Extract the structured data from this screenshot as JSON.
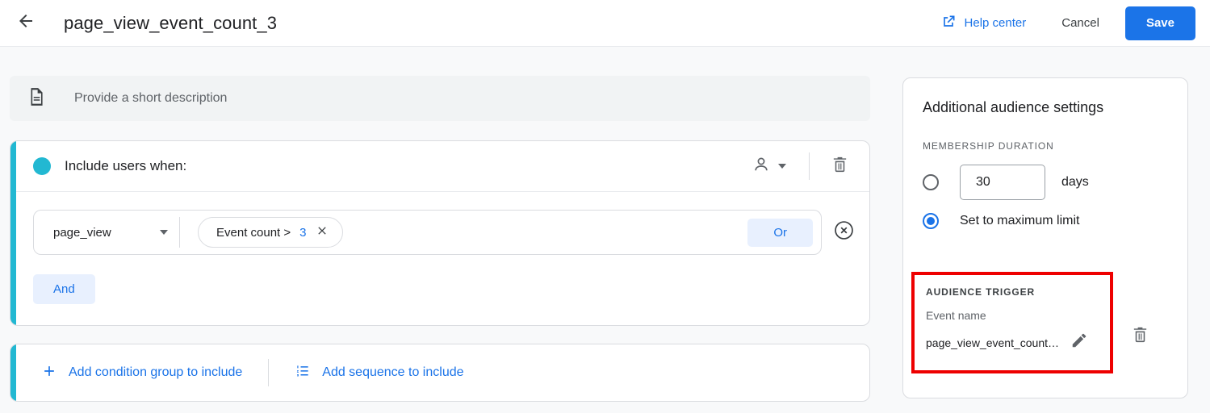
{
  "header": {
    "back_icon": "arrow-left-icon",
    "title": "page_view_event_count_3",
    "help_center_label": "Help center",
    "help_center_icon": "external-link-icon",
    "cancel_label": "Cancel",
    "save_label": "Save",
    "save_color": "#1b74e8",
    "help_link_color": "#1a73e8"
  },
  "description": {
    "icon": "document-icon",
    "placeholder": "Provide a short description"
  },
  "condition_card": {
    "accent_color": "#22b8d2",
    "header_label": "Include users when:",
    "scope_icon": "person-icon",
    "delete_icon": "trash-icon",
    "condition": {
      "dimension": "page_view",
      "chip_prefix": "Event count >",
      "chip_value": "3",
      "chip_close_icon": "close-icon",
      "or_label": "Or",
      "remove_icon": "circle-close-icon"
    },
    "and_label": "And"
  },
  "add_card": {
    "add_group_label": "Add condition group to include",
    "add_group_icon": "plus-icon",
    "add_sequence_label": "Add sequence to include",
    "add_sequence_icon": "numbered-list-icon"
  },
  "settings_panel": {
    "title": "Additional audience settings",
    "membership_duration_label": "MEMBERSHIP DURATION",
    "days_value": "30",
    "days_unit": "days",
    "max_limit_label": "Set to maximum limit",
    "selected_option": "max_limit",
    "accent_color": "#1a73e8",
    "audience_trigger": {
      "label": "AUDIENCE TRIGGER",
      "field_label": "Event name",
      "value": "page_view_event_count…",
      "edit_icon": "pencil-icon",
      "delete_icon": "trash-icon",
      "highlight_color": "#ee0000"
    }
  }
}
